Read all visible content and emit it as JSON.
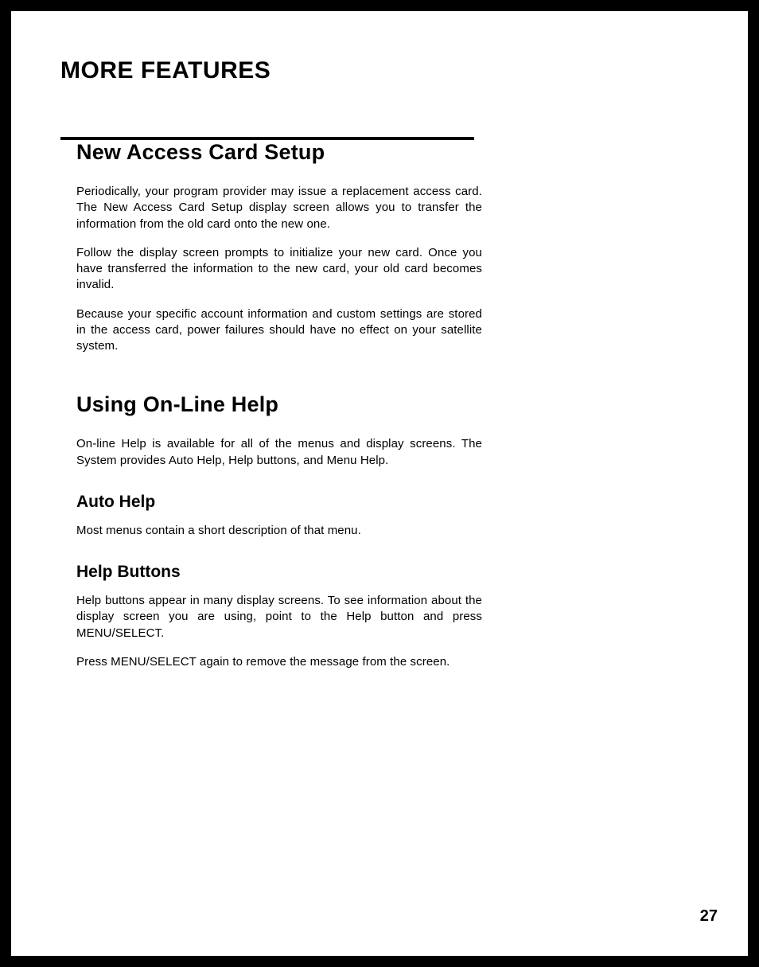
{
  "header": {
    "title": "MORE FEATURES"
  },
  "sections": {
    "newAccess": {
      "heading": "New Access Card Setup",
      "p1": "Periodically, your program provider may issue a replacement access card. The New Access Card Setup display screen allows you to transfer the information from the old card onto the new one.",
      "p2": "Follow the display screen prompts to initialize your new card. Once you have transferred the information to the new card, your old card becomes invalid.",
      "p3": "Because your specific account information and custom settings are stored in the access card, power failures should have no effect on your satellite system."
    },
    "onlineHelp": {
      "heading": "Using On-Line Help",
      "p1": "On-line Help is available for all of the menus and display screens. The System provides Auto Help, Help buttons, and Menu Help.",
      "autoHelp": {
        "heading": "Auto Help",
        "p1": "Most menus contain a short description of that menu."
      },
      "helpButtons": {
        "heading": "Help Buttons",
        "p1": "Help buttons appear in many display screens. To see information about the display screen you are using, point to the Help button and press MENU/SELECT.",
        "p2": "Press MENU/SELECT again to remove the message from the screen."
      }
    }
  },
  "pageNumber": "27"
}
